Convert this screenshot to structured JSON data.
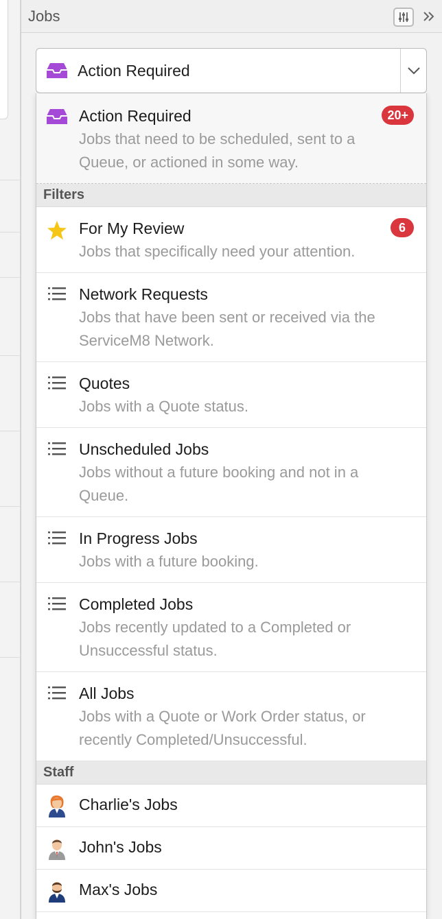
{
  "panel": {
    "title": "Jobs",
    "settings_icon": "sliders-icon",
    "collapse_icon": "double-chevron-right-icon"
  },
  "select": {
    "value": "Action Required",
    "icon": "inbox-tray-icon",
    "arrow_icon": "chevron-down-icon"
  },
  "colors": {
    "accent_purple": "#a54ad6",
    "badge_red": "#d9363e",
    "star_yellow": "#f5c518"
  },
  "dropdown": {
    "selected": {
      "title": "Action Required",
      "desc": "Jobs that need to be scheduled, sent to a Queue, or actioned in some way.",
      "badge": "20+",
      "icon": "inbox-tray-icon"
    },
    "filters_header": "Filters",
    "filters": [
      {
        "title": "For My Review",
        "desc": "Jobs that specifically need your attention.",
        "badge": "6",
        "icon": "star-icon"
      },
      {
        "title": "Network Requests",
        "desc": "Jobs that have been sent or received via the ServiceM8 Network.",
        "icon": "list-icon"
      },
      {
        "title": "Quotes",
        "desc": "Jobs with a Quote status.",
        "icon": "list-icon"
      },
      {
        "title": "Unscheduled Jobs",
        "desc": "Jobs without a future booking and not in a Queue.",
        "icon": "list-icon"
      },
      {
        "title": "In Progress Jobs",
        "desc": "Jobs with a future booking.",
        "icon": "list-icon"
      },
      {
        "title": "Completed Jobs",
        "desc": "Jobs recently updated to a Completed or Unsuccessful status.",
        "icon": "list-icon"
      },
      {
        "title": "All Jobs",
        "desc": "Jobs with a Quote or Work Order status, or recently Completed/Unsuccessful.",
        "icon": "list-icon"
      }
    ],
    "staff_header": "Staff",
    "staff": [
      {
        "title": "Charlie's Jobs",
        "icon": "staff-avatar-female-icon"
      },
      {
        "title": "John's Jobs",
        "icon": "staff-avatar-male-icon"
      },
      {
        "title": "Max's Jobs",
        "icon": "staff-avatar-bearded-icon"
      }
    ]
  }
}
